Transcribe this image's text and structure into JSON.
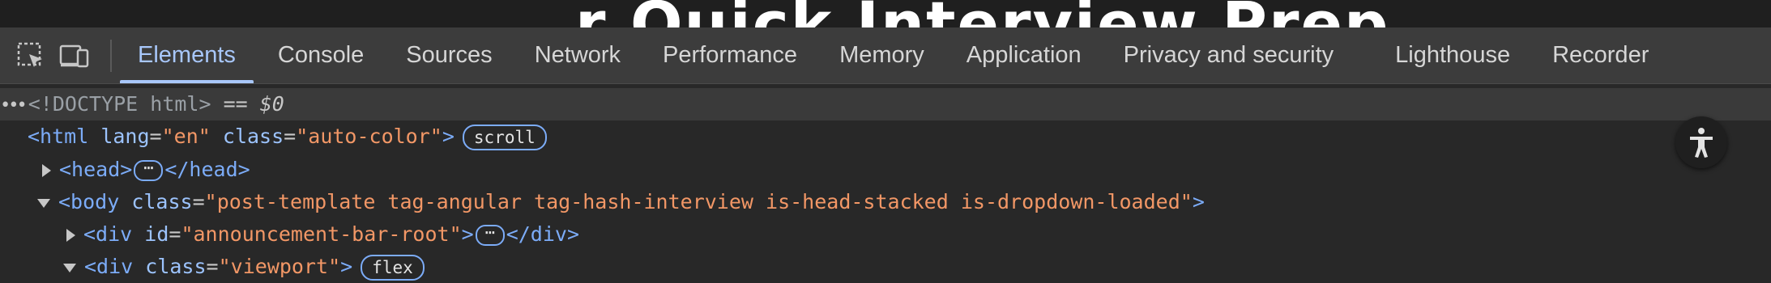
{
  "page": {
    "headline_fragment": "r Quick  Interview Prep"
  },
  "toolbar": {
    "tabs": [
      {
        "label": "Elements",
        "active": true
      },
      {
        "label": "Console"
      },
      {
        "label": "Sources"
      },
      {
        "label": "Network"
      },
      {
        "label": "Performance"
      },
      {
        "label": "Memory"
      },
      {
        "label": "Application"
      },
      {
        "label": "Privacy and security"
      },
      {
        "label": "Lighthouse"
      },
      {
        "label": "Recorder"
      }
    ]
  },
  "dom_tree": {
    "doctype_line": {
      "text": "<!DOCTYPE html>",
      "eq": " == ",
      "var": "$0"
    },
    "html_line": {
      "open": "<html",
      "attr1_name": "lang",
      "attr1_val": "\"en\"",
      "attr2_name": "class",
      "attr2_val": "\"auto-color\"",
      "close": ">",
      "badge": "scroll"
    },
    "head_line": {
      "open": "<head>",
      "ellipsis": "⋯",
      "close": "</head>"
    },
    "body_line": {
      "open": "<body",
      "attr_name": "class",
      "attr_val": "\"post-template tag-angular tag-hash-interview is-head-stacked is-dropdown-loaded\"",
      "close": ">"
    },
    "div1_line": {
      "open": "<div",
      "attr_name": "id",
      "attr_val": "\"announcement-bar-root\"",
      "close": ">",
      "ellipsis": "⋯",
      "end": "</div>"
    },
    "div2_line": {
      "open": "<div",
      "attr_name": "class",
      "attr_val": "\"viewport\"",
      "close": ">",
      "badge": "flex"
    }
  },
  "colors": {
    "accent": "#a8c7fa",
    "tag": "#7cacf8",
    "attr_value": "#f29766",
    "toolbar_bg": "#3c3c3c",
    "panel_bg": "#282828"
  },
  "icons": {
    "inspect": "inspect-element-icon",
    "device": "device-toolbar-icon",
    "accessibility": "accessibility-icon"
  }
}
